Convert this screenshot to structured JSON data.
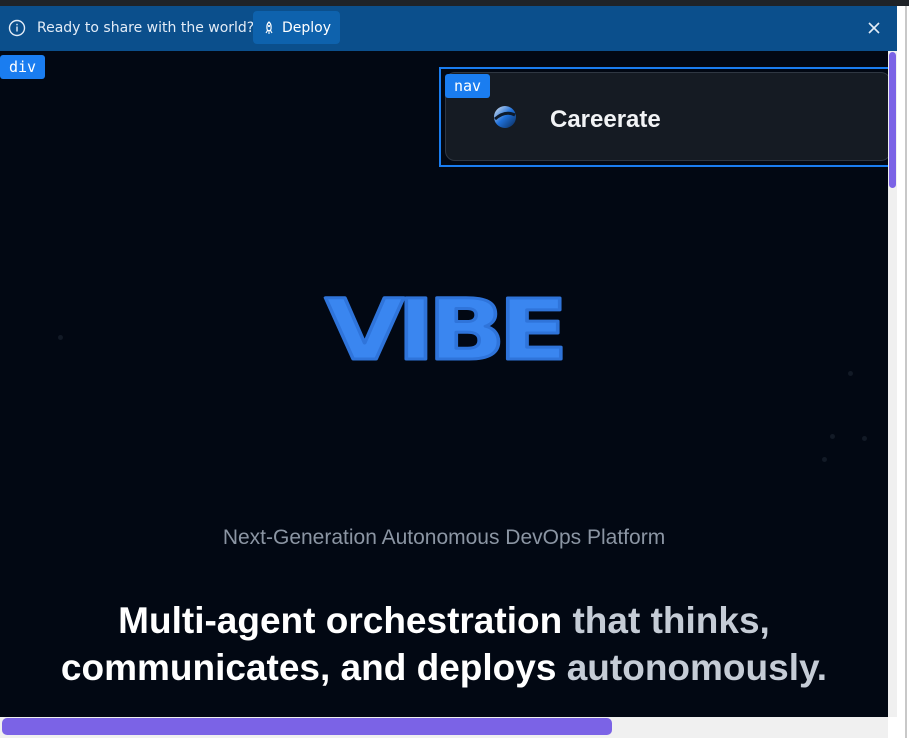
{
  "banner": {
    "message": "Ready to share with the world?",
    "deploy_label": "Deploy",
    "info_icon": "info-icon",
    "close_icon": "close-icon"
  },
  "inspector": {
    "div_tag": "div",
    "nav_tag": "nav"
  },
  "nav": {
    "brand": "Careerate",
    "logo_icon": "brand-logo"
  },
  "hero": {
    "wordmark": "VIBE",
    "subtitle": "Next-Generation Autonomous DevOps Platform",
    "headline_part1": "Multi-agent orchestration",
    "headline_part2": "that thinks,",
    "headline_part3": "communicates, and deploys",
    "headline_part4": "autonomously."
  },
  "colors": {
    "banner_bg": "#0b4f8c",
    "page_bg": "#020813",
    "accent": "#1a7df0",
    "wordmark": "#3a86f0",
    "scroll_thumb": "#7b63e6"
  }
}
